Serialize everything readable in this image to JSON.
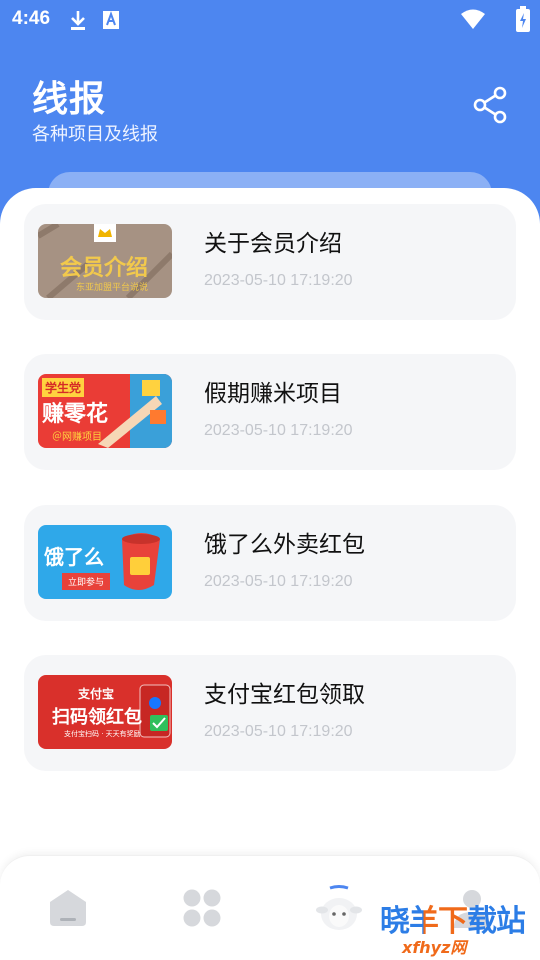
{
  "status_bar": {
    "time": "4:46",
    "icons": [
      "download-icon",
      "text-box-icon",
      "wifi-icon",
      "battery-charging-icon"
    ]
  },
  "header": {
    "title": "线报",
    "subtitle": "各种项目及线报",
    "share_icon": "share-icon",
    "background_color": "#4d86f0"
  },
  "items": [
    {
      "title": "关于会员介绍",
      "date": "2023-05-10 17:19:20",
      "thumb": {
        "main": "会员介绍",
        "caption": "东亚加盟平台说说"
      }
    },
    {
      "title": "假期赚米项目",
      "date": "2023-05-10 17:19:20",
      "thumb": {
        "tag": "学生党",
        "main": "赚零花",
        "caption": "＠网赚项目"
      }
    },
    {
      "title": "饿了么外卖红包",
      "date": "2023-05-10 17:19:20",
      "thumb": {
        "main": "饿了么",
        "caption": "立即参与"
      }
    },
    {
      "title": "支付宝红包领取",
      "date": "2023-05-10 17:19:20",
      "thumb": {
        "tag": "支付宝",
        "main": "扫码领红包",
        "caption": "支付宝扫码 · 天天有奖励"
      }
    }
  ],
  "bottom_nav": {
    "items": [
      {
        "icon": "home-icon"
      },
      {
        "icon": "grid-icon"
      },
      {
        "icon": "sheep-icon"
      },
      {
        "icon": "profile-icon"
      }
    ]
  },
  "watermark": {
    "main": "晓羊下载站",
    "sub": "xfhyz网"
  }
}
